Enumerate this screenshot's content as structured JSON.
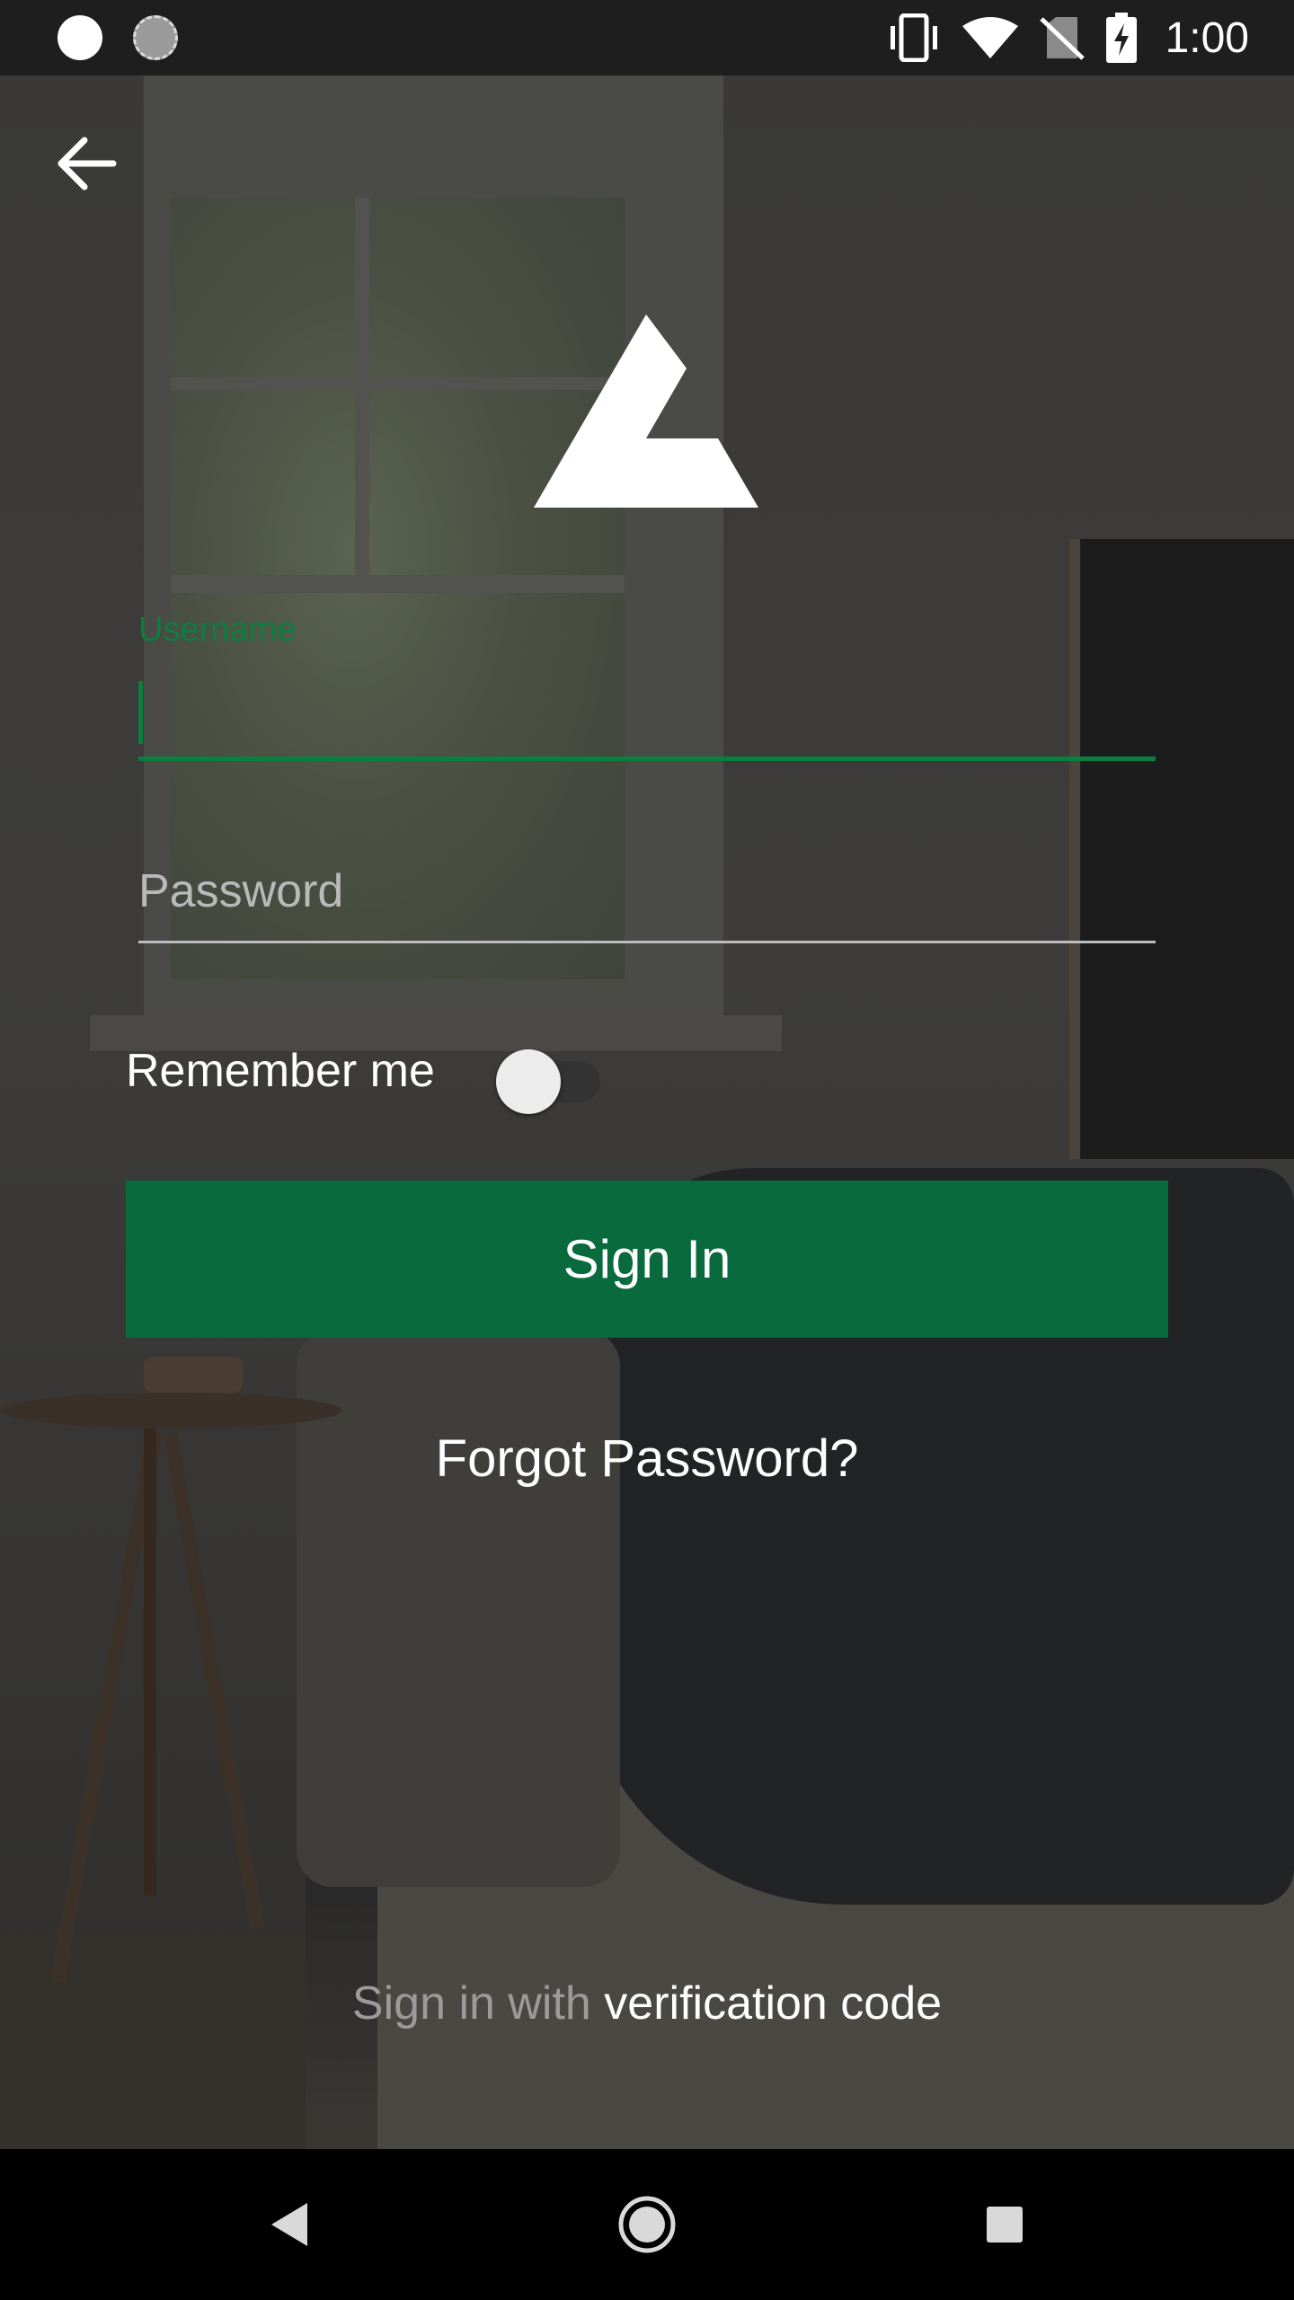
{
  "status_bar": {
    "time": "1:00",
    "icons": [
      "notification-dot-icon",
      "sync-icon",
      "vibrate-icon",
      "wifi-icon",
      "no-sim-icon",
      "battery-charging-icon"
    ]
  },
  "login": {
    "username_label": "Username",
    "username_value": "",
    "password_placeholder": "Password",
    "remember_label": "Remember me",
    "remember_enabled": false,
    "sign_in_label": "Sign In",
    "forgot_label": "Forgot Password?",
    "alt_prefix": "Sign in with",
    "alt_link": "verification code"
  },
  "colors": {
    "accent": "#0a7f3f",
    "button": "#086a3d"
  }
}
